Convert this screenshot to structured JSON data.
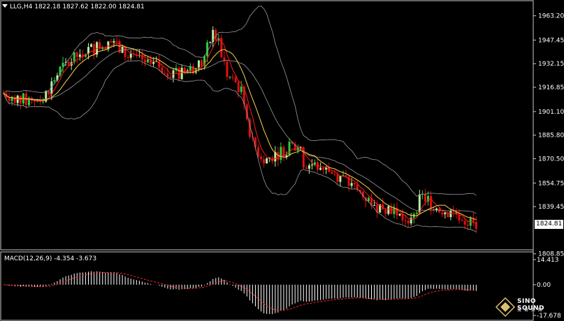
{
  "chart_data": [
    {
      "type": "candlestick",
      "header": {
        "symbol": "LLG,H4",
        "open": "1822.18",
        "high": "1827.62",
        "low": "1822.00",
        "close": "1824.81"
      },
      "current_price": 1824.81,
      "current_price_label": "1824.81",
      "y_ticks": [
        "1963.20",
        "1947.45",
        "1932.15",
        "1916.85",
        "1901.10",
        "1885.80",
        "1870.50",
        "1854.75",
        "1839.45",
        "1808.85"
      ],
      "ylim": [
        1806.0,
        1968.0
      ],
      "colors": {
        "up": "#2ecc40",
        "up_light": "#b8f0a0",
        "down": "#e01010",
        "bollinger": "#9a9a9a",
        "ma_fast": "#ff1a1a",
        "ma_slow": "#ffd24a"
      },
      "indicators": [
        "Bollinger Bands",
        "Moving Average (fast)",
        "Moving Average (slow)"
      ]
    },
    {
      "type": "histogram+line",
      "header": "MACD(12,26,9) -4.354 -3.673",
      "y_ticks": [
        "14.413",
        "0.00",
        "-17.678"
      ],
      "ylim": [
        -17.678,
        14.413
      ],
      "colors": {
        "bars": "#ffffff",
        "signal": "#ff2020"
      }
    }
  ],
  "logo": {
    "line1": "SINO SOUND",
    "line2": "漢 聲 集 團"
  }
}
